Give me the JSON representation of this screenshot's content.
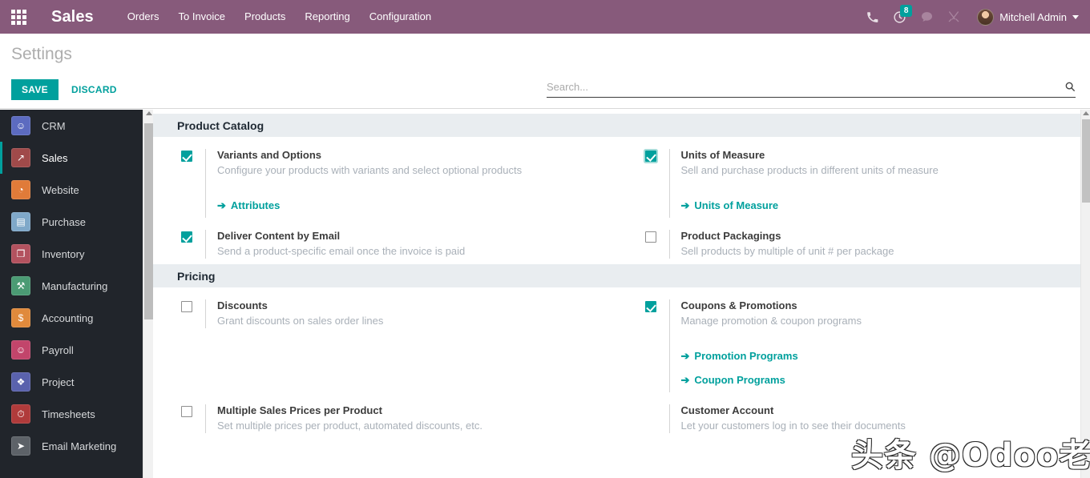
{
  "navbar": {
    "apps_icon": "apps-grid-icon",
    "brand": "Sales",
    "menu": [
      {
        "label": "Orders"
      },
      {
        "label": "To Invoice"
      },
      {
        "label": "Products"
      },
      {
        "label": "Reporting"
      },
      {
        "label": "Configuration"
      }
    ],
    "icons": [
      {
        "name": "phone-icon",
        "glyph": "✆"
      },
      {
        "name": "activity-clock-icon",
        "glyph": "◴",
        "badge": "8"
      },
      {
        "name": "messages-chat-icon",
        "glyph": "💬"
      },
      {
        "name": "developer-tools-icon",
        "glyph": "⚒"
      }
    ],
    "activity_count": "8",
    "user_name": "Mitchell Admin",
    "background_color": "#875A7B"
  },
  "control_panel": {
    "title": "Settings",
    "save_label": "SAVE",
    "discard_label": "DISCARD",
    "accent_color": "#00A09D",
    "search_placeholder": "Search...",
    "search_value": "",
    "search_icon": "magnifier-icon"
  },
  "sidebar": {
    "items": [
      {
        "label": "CRM",
        "icon": "crm-handshake-icon",
        "color": "#5c6bc0",
        "glyph": "☺",
        "active": false
      },
      {
        "label": "Sales",
        "icon": "sales-chart-icon",
        "color": "#a04a4a",
        "glyph": "↗",
        "active": true
      },
      {
        "label": "Website",
        "icon": "website-globe-icon",
        "color": "#e07b39",
        "glyph": "◔",
        "active": false
      },
      {
        "label": "Purchase",
        "icon": "purchase-card-icon",
        "color": "#7fa8c9",
        "glyph": "▤",
        "active": false
      },
      {
        "label": "Inventory",
        "icon": "inventory-box-icon",
        "color": "#b3525f",
        "glyph": "❐",
        "active": false
      },
      {
        "label": "Manufacturing",
        "icon": "manufacturing-wrench-icon",
        "color": "#4b9b74",
        "glyph": "⚒",
        "active": false
      },
      {
        "label": "Accounting",
        "icon": "accounting-invoice-icon",
        "color": "#e08a3c",
        "glyph": "$",
        "active": false
      },
      {
        "label": "Payroll",
        "icon": "payroll-person-icon",
        "color": "#c2456b",
        "glyph": "☺",
        "active": false
      },
      {
        "label": "Project",
        "icon": "project-puzzle-icon",
        "color": "#5a62ad",
        "glyph": "❖",
        "active": false
      },
      {
        "label": "Timesheets",
        "icon": "timesheets-stopwatch-icon",
        "color": "#b03b3b",
        "glyph": "⏱",
        "active": false
      },
      {
        "label": "Email Marketing",
        "icon": "email-marketing-send-icon",
        "color": "#5d6268",
        "glyph": "➤",
        "active": false
      }
    ]
  },
  "settings": {
    "sections": [
      {
        "title": "Product Catalog",
        "rows": [
          {
            "left": {
              "name": "Variants and Options",
              "description": "Configure your products with variants and select optional products",
              "checkbox": "checked",
              "focused": false,
              "links": [
                {
                  "label": "Attributes"
                }
              ]
            },
            "right": {
              "name": "Units of Measure",
              "description": "Sell and purchase products in different units of measure",
              "checkbox": "checked",
              "focused": true,
              "links": [
                {
                  "label": "Units of Measure"
                }
              ]
            }
          },
          {
            "left": {
              "name": "Deliver Content by Email",
              "description": "Send a product-specific email once the invoice is paid",
              "checkbox": "checked",
              "focused": false,
              "links": []
            },
            "right": {
              "name": "Product Packagings",
              "description": "Sell products by multiple of unit # per package",
              "checkbox": "unchecked",
              "focused": false,
              "links": []
            }
          }
        ]
      },
      {
        "title": "Pricing",
        "rows": [
          {
            "left": {
              "name": "Discounts",
              "description": "Grant discounts on sales order lines",
              "checkbox": "unchecked",
              "focused": false,
              "links": []
            },
            "right": {
              "name": "Coupons & Promotions",
              "description": "Manage promotion & coupon programs",
              "checkbox": "checked",
              "focused": false,
              "links": [
                {
                  "label": "Promotion Programs"
                },
                {
                  "label": "Coupon Programs"
                }
              ]
            }
          },
          {
            "left": {
              "name": "Multiple Sales Prices per Product",
              "description": "Set multiple prices per product, automated discounts, etc.",
              "checkbox": "unchecked",
              "focused": false,
              "links": []
            },
            "right": {
              "name": "Customer Account",
              "description": "Let your customers log in to see their documents",
              "checkbox": "none",
              "focused": false,
              "links": []
            }
          }
        ]
      }
    ]
  },
  "watermark": {
    "text": "头条 @Odoo老杨"
  }
}
